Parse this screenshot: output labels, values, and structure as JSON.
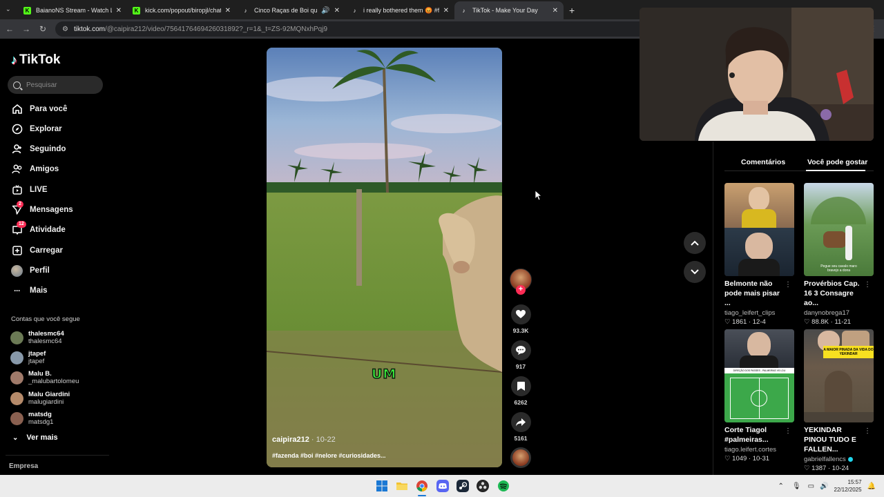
{
  "browser": {
    "tabs": [
      {
        "title": "BaianoNS Stream - Watch Live",
        "favicon": "kick-icon"
      },
      {
        "title": "kick.com/popout/biropjl/chat",
        "favicon": "kick-icon"
      },
      {
        "title": "Cinco Raças de Boi que Tod",
        "favicon": "tiktok-icon"
      },
      {
        "title": "i really bothered them 😡 #flo",
        "favicon": "tiktok-icon"
      },
      {
        "title": "TikTok - Make Your Day",
        "favicon": "tiktok-icon"
      }
    ],
    "url_host": "tiktok.com",
    "url_path": "/@caipira212/video/7564176469426031892?_r=1&_t=ZS-92MQNxhPqj9"
  },
  "sidebar": {
    "logo": "TikTok",
    "search_placeholder": "Pesquisar",
    "nav": [
      {
        "label": "Para você",
        "icon": "home-icon"
      },
      {
        "label": "Explorar",
        "icon": "compass-icon"
      },
      {
        "label": "Seguindo",
        "icon": "user-follow-icon"
      },
      {
        "label": "Amigos",
        "icon": "friends-icon"
      },
      {
        "label": "LIVE",
        "icon": "live-icon"
      },
      {
        "label": "Mensagens",
        "icon": "send-icon",
        "badge": "2"
      },
      {
        "label": "Atividade",
        "icon": "inbox-icon",
        "badge": "12"
      },
      {
        "label": "Carregar",
        "icon": "upload-icon"
      },
      {
        "label": "Perfil",
        "icon": "profile-avatar"
      },
      {
        "label": "Mais",
        "icon": "more-icon"
      }
    ],
    "following_title": "Contas que você segue",
    "following": [
      {
        "name": "thalesmc64",
        "handle": "thalesmc64",
        "color": "#6b7a55"
      },
      {
        "name": "jtapef",
        "handle": "jtapef",
        "color": "#8899aa"
      },
      {
        "name": "Malu B.",
        "handle": "_malubartolomeu",
        "color": "#a07a6a"
      },
      {
        "name": "Malu Giardini",
        "handle": "malugiardini",
        "color": "#b58a6a"
      },
      {
        "name": "matsdg",
        "handle": "matsdg1",
        "color": "#8a6050"
      }
    ],
    "see_more": "Ver mais",
    "footer": "Empresa"
  },
  "video": {
    "caption_word": "UM",
    "author": "caipira212",
    "date": " · 10-22",
    "hashtags": "#fazenda #boi #nelore #curiosidades..."
  },
  "actions": {
    "likes": "93.3K",
    "comments": "917",
    "saves": "6262",
    "shares": "5161"
  },
  "right_panel": {
    "tabs": [
      "Comentários",
      "Você pode gostar"
    ],
    "cards": [
      {
        "title": "Belmonte não pode mais pisar ...",
        "author": "tiago_leifert_clips",
        "likes": "♡ 1861",
        "date": "12-4",
        "verified": false
      },
      {
        "title": "Provérbios Cap. 16 3 Consagre ao...",
        "author": "danynobrega17",
        "likes": "♡ 88.8K",
        "date": "11-21",
        "verified": false
      },
      {
        "title": "Corte Tiagol #palmeiras...",
        "author": "tiago.leifert.cortes",
        "likes": "♡ 1049",
        "date": "10-31",
        "verified": false
      },
      {
        "title": "YEKINDAR PINOU TUDO E FALLEN...",
        "author": "gabrielfallencs",
        "likes": "♡ 1387",
        "date": "10-24",
        "verified": true
      }
    ],
    "card_overlays": {
      "card2": "Pegue seu cavalo maro\nbravejo a dona",
      "card3": "DIREÇÃO DOS PASSES - PALMEIRAS VS LDU",
      "card4": "A MAIOR PINADA DA VIDA DO YEKINDAR"
    }
  },
  "taskbar": {
    "time": "15:57",
    "date": "22/12/2025"
  }
}
